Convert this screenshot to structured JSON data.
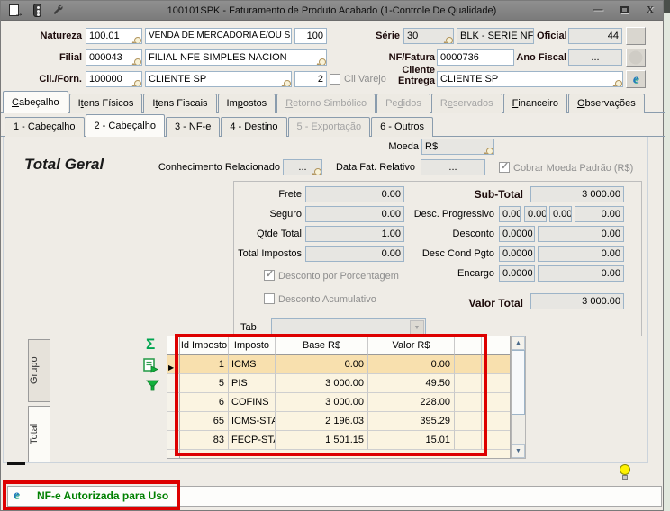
{
  "window": {
    "title": "100101SPK - Faturamento de Produto Acabado (1-Controle De Qualidade)",
    "toolbar_icons": [
      "export-document-icon",
      "traffic-light-icon",
      "wrench-icon"
    ],
    "control_icons": [
      "minimize-icon",
      "maximize-icon",
      "close-icon"
    ]
  },
  "form": {
    "natureza": {
      "label": "Natureza",
      "code": "100.01",
      "desc": "VENDA DE MERCADORIA E/OU SERVI",
      "extra": "100"
    },
    "filial": {
      "label": "Filial",
      "code": "000043",
      "desc": "FILIAL NFE SIMPLES NACION"
    },
    "cli_forn": {
      "label": "Cli./Forn.",
      "code": "100000",
      "desc": "CLIENTE SP",
      "loja": "2"
    },
    "cli_varejo": {
      "label": "Cli Varejo",
      "checked": false
    },
    "serie": {
      "label": "Série",
      "code": "30",
      "desc": "BLK - SERIE NFE"
    },
    "oficial": {
      "label": "Oficial",
      "value": "44"
    },
    "nf_fatura": {
      "label": "NF/Fatura",
      "value": "0000736"
    },
    "ano_fiscal": {
      "label": "Ano Fiscal",
      "value": "..."
    },
    "cliente_entrega": {
      "label1": "Cliente",
      "label2": "Entrega",
      "value": "CLIENTE SP"
    }
  },
  "tabs": {
    "main": [
      {
        "label": "Cabeçalho",
        "accel": 0,
        "active": true
      },
      {
        "label": "Itens Físicos",
        "accel": 1
      },
      {
        "label": "Itens Fiscais",
        "accel": 1
      },
      {
        "label": "Impostos",
        "accel": 2
      },
      {
        "label": "Retorno Simbólico",
        "accel": 0,
        "disabled": true
      },
      {
        "label": "Pedidos",
        "accel": 2,
        "disabled": true
      },
      {
        "label": "Reservados",
        "accel": 1,
        "disabled": true
      },
      {
        "label": "Financeiro",
        "accel": 0
      },
      {
        "label": "Observações",
        "accel": 0
      }
    ],
    "sub": [
      {
        "label": "1 - Cabeçalho"
      },
      {
        "label": "2 - Cabeçalho",
        "active": true
      },
      {
        "label": "3 - NF-e"
      },
      {
        "label": "4 - Destino"
      },
      {
        "label": "5 - Exportação",
        "disabled": true
      },
      {
        "label": "6 - Outros"
      }
    ]
  },
  "page": {
    "moeda": {
      "label": "Moeda",
      "value": "R$"
    },
    "section_title": "Total Geral",
    "conhecimento": {
      "label": "Conhecimento Relacionado",
      "value": "..."
    },
    "data_fat": {
      "label": "Data Fat. Relativo",
      "value": "..."
    },
    "cobrar_moeda": {
      "label": "Cobrar Moeda Padrão (R$)",
      "checked": true
    },
    "totais": {
      "frete": {
        "label": "Frete",
        "value": "0.00"
      },
      "seguro": {
        "label": "Seguro",
        "value": "0.00"
      },
      "qtde_total": {
        "label": "Qtde Total",
        "value": "1.00"
      },
      "total_impostos": {
        "label": "Total Impostos",
        "value": "0.00"
      },
      "sub_total": {
        "label": "Sub-Total",
        "value": "3 000.00"
      },
      "desc_progressivo": {
        "label": "Desc. Progressivo",
        "values": [
          "0.00",
          "0.00",
          "0.00",
          "0.00"
        ]
      },
      "desconto": {
        "label": "Desconto",
        "pct": "0.0000",
        "value": "0.00"
      },
      "desc_cond_pgto": {
        "label": "Desc Cond Pgto",
        "pct": "0.0000",
        "value": "0.00"
      },
      "encargo": {
        "label": "Encargo",
        "pct": "0.0000",
        "value": "0.00"
      },
      "valor_total": {
        "label": "Valor Total",
        "value": "3 000.00"
      }
    },
    "checks": {
      "desconto_porcentagem": {
        "label": "Desconto por Porcentagem",
        "checked": true
      },
      "desconto_acumulativo": {
        "label": "Desconto Acumulativo",
        "checked": false
      }
    },
    "tab_combo": {
      "label": "Tab",
      "value": ""
    }
  },
  "grid": {
    "side_tabs": [
      {
        "label": "Grupo",
        "active": false
      },
      {
        "label": "Total",
        "active": true
      }
    ],
    "tool_icons": [
      "sigma-icon",
      "export-grid-icon",
      "filter-icon"
    ],
    "columns": [
      "Id Imposto",
      "Imposto",
      "Base R$",
      "Valor R$",
      ""
    ],
    "rows": [
      {
        "id": "1",
        "imposto": "ICMS",
        "base": "0.00",
        "valor": "0.00",
        "selected": true
      },
      {
        "id": "5",
        "imposto": "PIS",
        "base": "3 000.00",
        "valor": "49.50"
      },
      {
        "id": "6",
        "imposto": "COFINS",
        "base": "3 000.00",
        "valor": "228.00"
      },
      {
        "id": "65",
        "imposto": "ICMS-STA",
        "base": "2 196.03",
        "valor": "395.29"
      },
      {
        "id": "83",
        "imposto": "FECP-STA",
        "base": "1 501.15",
        "valor": "15.01"
      }
    ]
  },
  "status": {
    "message": "NF-e Autorizada para Uso"
  },
  "colors": {
    "annotation_red": "#DD0000",
    "status_green": "#008000",
    "selected_row": "#F8E0AE",
    "icon_green": "#00A550",
    "titlebar_gray": "#858585"
  }
}
